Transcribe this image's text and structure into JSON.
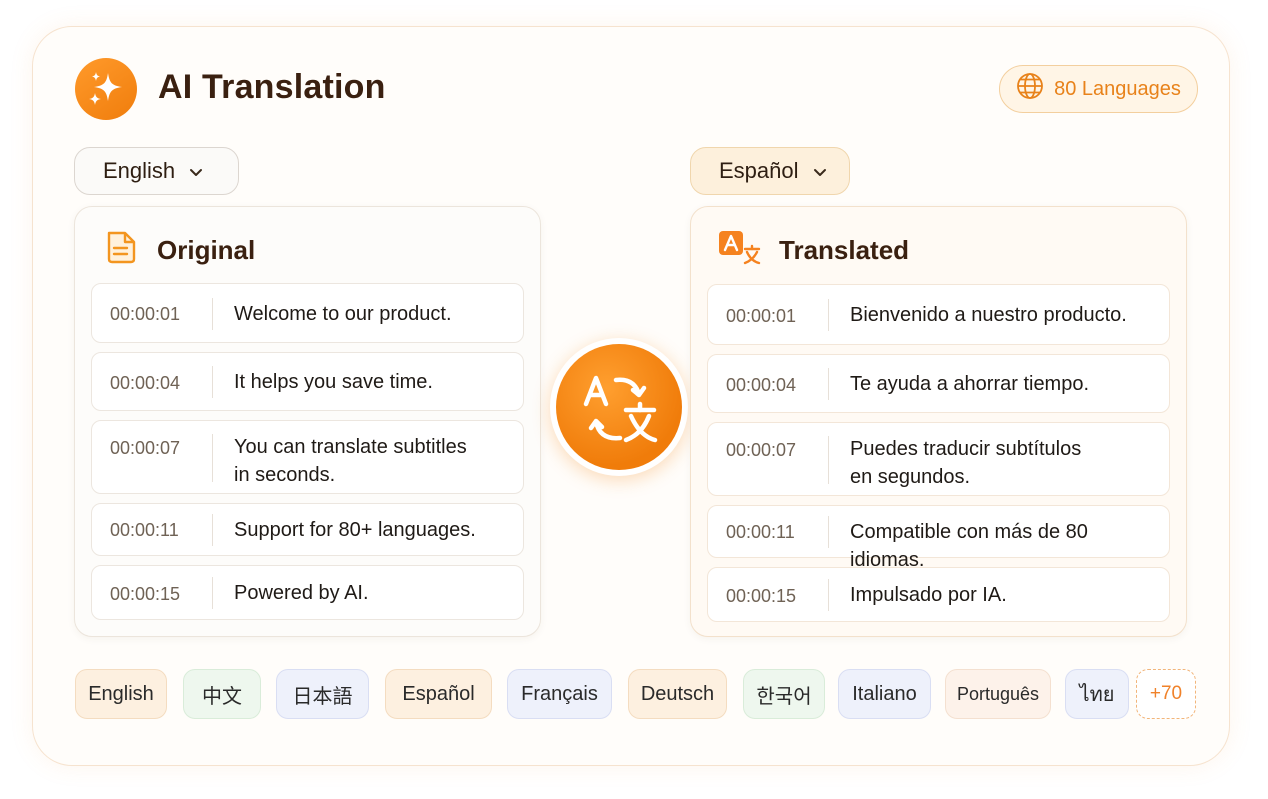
{
  "header": {
    "title": "AI Translation",
    "languages_badge": "80 Languages"
  },
  "source_select": {
    "value": "English"
  },
  "target_select": {
    "value": "Español"
  },
  "original_panel": {
    "title": "Original",
    "rows": [
      {
        "time": "00:00:01",
        "text": "Welcome to our product."
      },
      {
        "time": "00:00:04",
        "text": "It helps you save time."
      },
      {
        "time": "00:00:07",
        "text": "You can translate subtitles\nin seconds."
      },
      {
        "time": "00:00:11",
        "text": "Support for 80+ languages."
      },
      {
        "time": "00:00:15",
        "text": "Powered by AI."
      }
    ]
  },
  "translated_panel": {
    "title": "Translated",
    "rows": [
      {
        "time": "00:00:01",
        "text": "Bienvenido a nuestro producto."
      },
      {
        "time": "00:00:04",
        "text": "Te ayuda a ahorrar tiempo."
      },
      {
        "time": "00:00:07",
        "text": "Puedes traducir subtítulos\nen segundos."
      },
      {
        "time": "00:00:11",
        "text": "Compatible con más de 80 idiomas."
      },
      {
        "time": "00:00:15",
        "text": "Impulsado por IA."
      }
    ]
  },
  "language_chips": [
    {
      "label": "English",
      "style": "orange"
    },
    {
      "label": "中文",
      "style": "green"
    },
    {
      "label": "日本語",
      "style": "blue"
    },
    {
      "label": "Español",
      "style": "orange"
    },
    {
      "label": "Français",
      "style": "blue"
    },
    {
      "label": "Deutsch",
      "style": "orange"
    },
    {
      "label": "한국어",
      "style": "green"
    },
    {
      "label": "Italiano",
      "style": "blue"
    },
    {
      "label": "Português",
      "style": "peach"
    },
    {
      "label": "ไทย",
      "style": "blue"
    },
    {
      "label": "+70",
      "style": "more"
    }
  ],
  "icons": {
    "logo": "sparkles-icon",
    "badge": "globe-icon",
    "dropdown": "chevron-down-icon",
    "original": "document-icon",
    "translated": "translate-icon",
    "swap": "translate-swap-icon"
  },
  "colors": {
    "accent": "#f28a1a",
    "title": "#3a2010"
  }
}
